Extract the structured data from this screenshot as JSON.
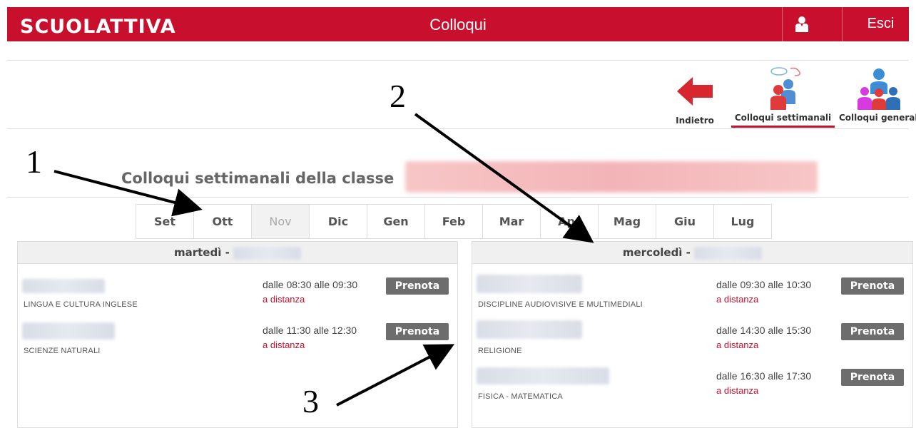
{
  "header": {
    "logo": "SCUOLATTIVA",
    "title": "Colloqui",
    "logout_label": "Esci"
  },
  "toolbar": {
    "back_label": "Indietro",
    "weekly_label": "Colloqui settimanali",
    "general_label": "Colloqui generali"
  },
  "section_title": "Colloqui settimanali della classe",
  "months": [
    "Set",
    "Ott",
    "Nov",
    "Dic",
    "Gen",
    "Feb",
    "Mar",
    "Apr",
    "Mag",
    "Giu",
    "Lug"
  ],
  "selected_month": "Nov",
  "days": [
    {
      "header": "martedì -",
      "slots": [
        {
          "subject": "LINGUA E CULTURA INGLESE",
          "time": "dalle 08:30 alle 09:30",
          "mode": "a distanza",
          "button": "Prenota"
        },
        {
          "subject": "SCIENZE NATURALI",
          "time": "dalle 11:30 alle 12:30",
          "mode": "a distanza",
          "button": "Prenota"
        }
      ]
    },
    {
      "header": "mercoledì -",
      "slots": [
        {
          "subject": "DISCIPLINE AUDIOVISIVE E MULTIMEDIALI",
          "time": "dalle 09:30 alle 10:30",
          "mode": "a distanza",
          "button": "Prenota"
        },
        {
          "subject": "RELIGIONE",
          "time": "dalle 14:30 alle 15:30",
          "mode": "a distanza",
          "button": "Prenota"
        },
        {
          "subject": "FISICA - MATEMATICA",
          "time": "dalle 16:30 alle 17:30",
          "mode": "a distanza",
          "button": "Prenota"
        }
      ]
    }
  ],
  "annotations": [
    "1",
    "2",
    "3"
  ],
  "colors": {
    "brand": "#c8102e",
    "button": "#6d6d6d"
  }
}
